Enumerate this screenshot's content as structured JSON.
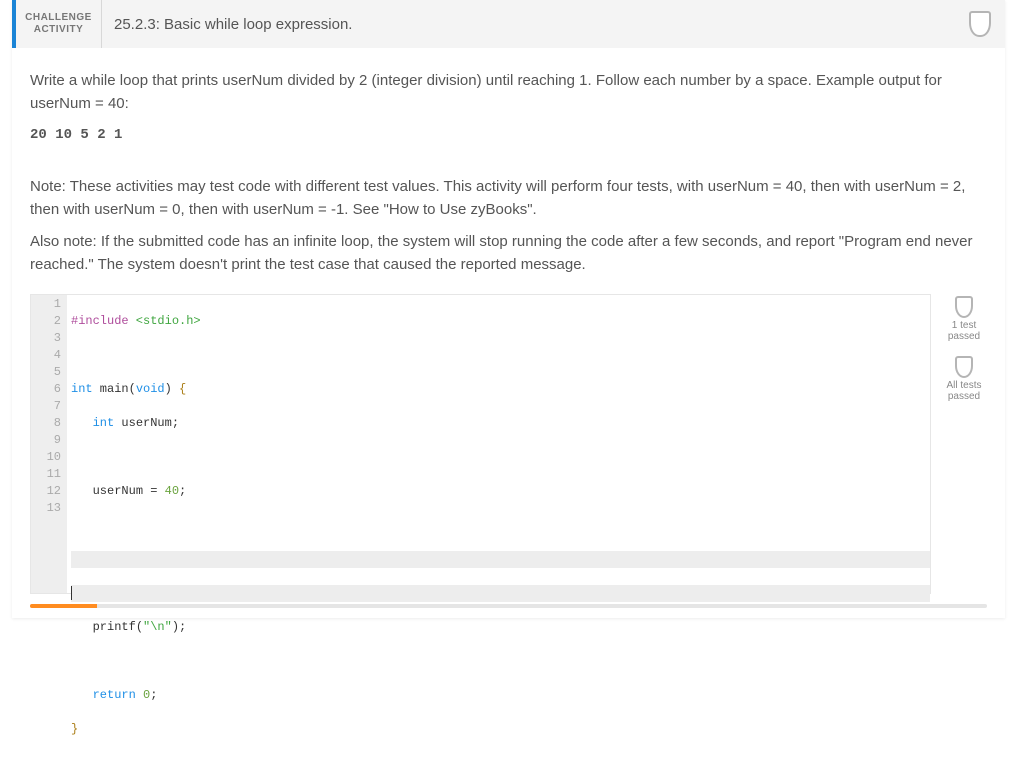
{
  "header": {
    "badge_line1": "CHALLENGE",
    "badge_line2": "ACTIVITY",
    "title": "25.2.3: Basic while loop expression."
  },
  "prompt": {
    "p1": "Write a while loop that prints userNum divided by 2 (integer division) until reaching 1. Follow each number by a space. Example output for userNum = 40:",
    "sample": "20 10 5 2 1",
    "note1": "Note: These activities may test code with different test values. This activity will perform four tests, with userNum = 40, then with userNum = 2, then with userNum = 0, then with userNum = -1. See \"How to Use zyBooks\".",
    "note2": "Also note: If the submitted code has an infinite loop, the system will stop running the code after a few seconds, and report \"Program end never reached.\" The system doesn't print the test case that caused the reported message."
  },
  "code": {
    "line1_include": "#include",
    "line1_hdr": " <stdio.h>",
    "line3_int": "int",
    "line3_main": " main(",
    "line3_void": "void",
    "line3_close": ") ",
    "line3_brace": "{",
    "line4_indent": "   ",
    "line4_int": "int",
    "line4_rest": " userNum;",
    "line6_indent": "   ",
    "line6_text": "userNum = ",
    "line6_num": "40",
    "line6_semi": ";",
    "line10_indent": "   ",
    "line10_text": "printf(",
    "line10_str": "\"\\n\"",
    "line10_close": ");",
    "line12_indent": "   ",
    "line12_return": "return",
    "line12_sp": " ",
    "line12_num": "0",
    "line12_semi": ";",
    "line13_brace": "}"
  },
  "gutter": [
    "1",
    "2",
    "3",
    "4",
    "5",
    "6",
    "7",
    "8",
    "9",
    "10",
    "11",
    "12",
    "13"
  ],
  "side": {
    "one_test": "1 test",
    "passed": "passed",
    "all_tests": "All tests"
  },
  "progress_pct": 7
}
